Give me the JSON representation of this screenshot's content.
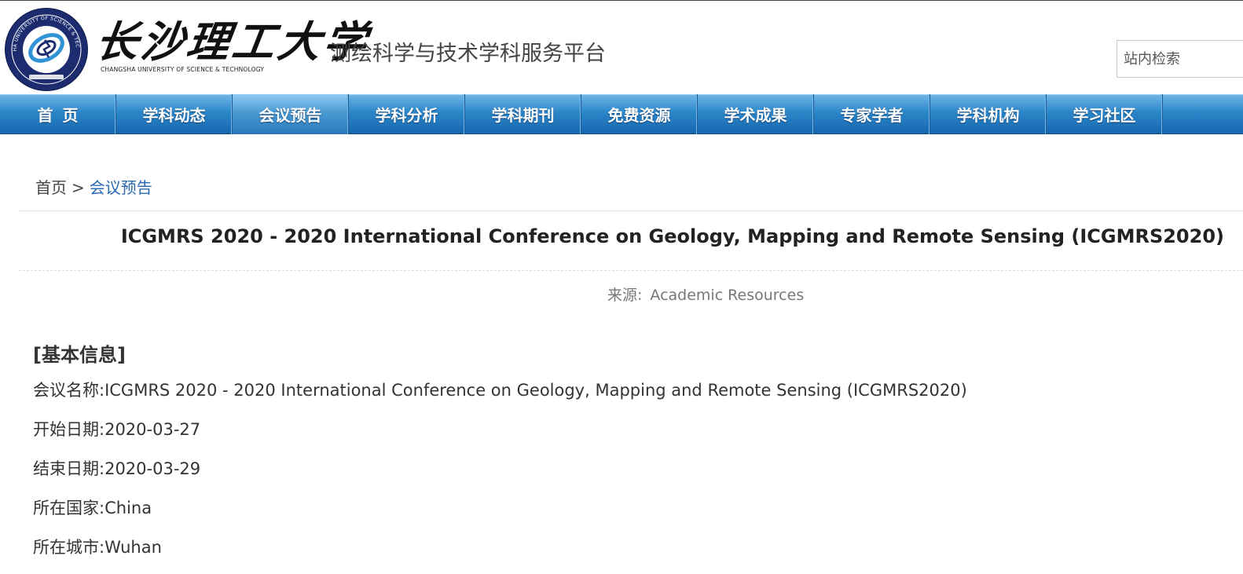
{
  "header": {
    "university_name_cn": "长沙理工大学",
    "university_name_en": "CHANGSHA UNIVERSITY OF SCIENCE & TECHNOLOGY",
    "platform_title": "测绘科学与技术学科服务平台",
    "search_placeholder": "站内检索",
    "seal_text": "CHANGSHA UNIVERSITY OF SCIENCE & TECHNOLOGY"
  },
  "nav": {
    "items": [
      {
        "label": "首页"
      },
      {
        "label": "学科动态"
      },
      {
        "label": "会议预告"
      },
      {
        "label": "学科分析"
      },
      {
        "label": "学科期刊"
      },
      {
        "label": "免费资源"
      },
      {
        "label": "学术成果"
      },
      {
        "label": "专家学者"
      },
      {
        "label": "学科机构"
      },
      {
        "label": "学习社区"
      }
    ],
    "active_index": 2
  },
  "breadcrumb": {
    "home": "首页",
    "separator": ">",
    "current": "会议预告"
  },
  "article": {
    "title": "ICGMRS 2020 - 2020 International Conference on Geology, Mapping and Remote Sensing (ICGMRS2020)",
    "source_label": "来源:",
    "source_value": "Academic Resources",
    "section_title": "[基本信息]",
    "info": [
      {
        "label": "会议名称:",
        "value": "ICGMRS 2020 - 2020 International Conference on Geology, Mapping and Remote Sensing (ICGMRS2020)"
      },
      {
        "label": "开始日期:",
        "value": "2020-03-27"
      },
      {
        "label": "结束日期:",
        "value": "2020-03-29"
      },
      {
        "label": "所在国家:",
        "value": "China"
      },
      {
        "label": "所在城市:",
        "value": "Wuhan"
      }
    ]
  },
  "colors": {
    "nav_blue": "#2b86c8",
    "link_blue": "#2a6ab0",
    "seal_navy": "#1c2c6e"
  }
}
